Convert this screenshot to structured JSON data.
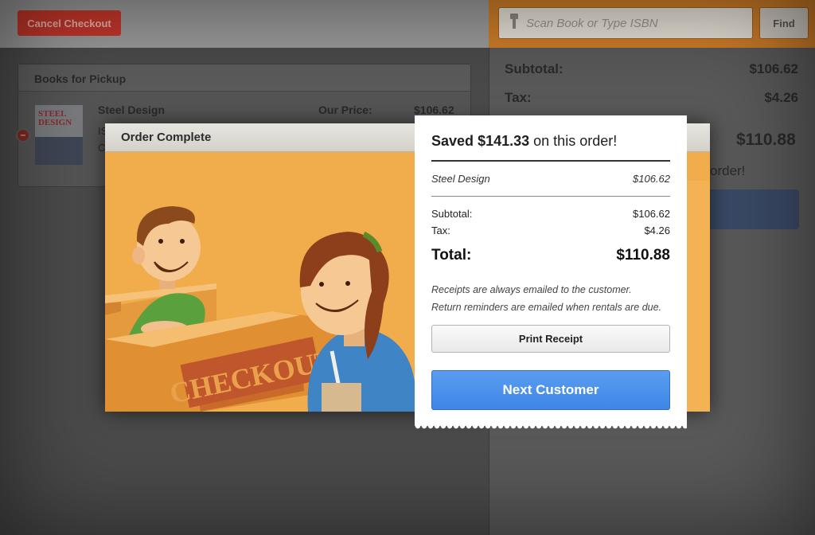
{
  "toolbar": {
    "cancel_label": "Cancel Checkout",
    "scan_placeholder": "Scan Book or Type ISBN",
    "find_label": "Find"
  },
  "pickup": {
    "title": "Books for Pickup",
    "book_title": "Steel Design",
    "cover_text": "STEEL DESIGN",
    "fragment1": "IS",
    "fragment2": "C",
    "our_price_label": "Our Price:",
    "our_price_value": "$106.62",
    "remove_symbol": "–"
  },
  "summary": {
    "subtotal_label": "Subtotal:",
    "subtotal_value": "$106.62",
    "tax_label": "Tax:",
    "tax_value": "$4.26",
    "total_value": "$110.88",
    "saved_fragment": "order!"
  },
  "modal": {
    "title": "Order Complete",
    "sign_text": "CHECKOUT"
  },
  "receipt": {
    "saved_prefix": "Saved",
    "saved_amount": "$141.33",
    "saved_suffix": "on this order!",
    "item_name": "Steel Design",
    "item_price": "$106.62",
    "subtotal_label": "Subtotal:",
    "subtotal_value": "$106.62",
    "tax_label": "Tax:",
    "tax_value": "$4.26",
    "total_label": "Total:",
    "total_value": "$110.88",
    "note1": "Receipts are always emailed to the customer.",
    "note2": "Return reminders are emailed when rentals are due.",
    "print_label": "Print Receipt",
    "next_label": "Next Customer"
  },
  "colors": {
    "accent_orange": "#cf7e28",
    "cancel_red": "#c8372b",
    "next_blue": "#3f86e6"
  }
}
